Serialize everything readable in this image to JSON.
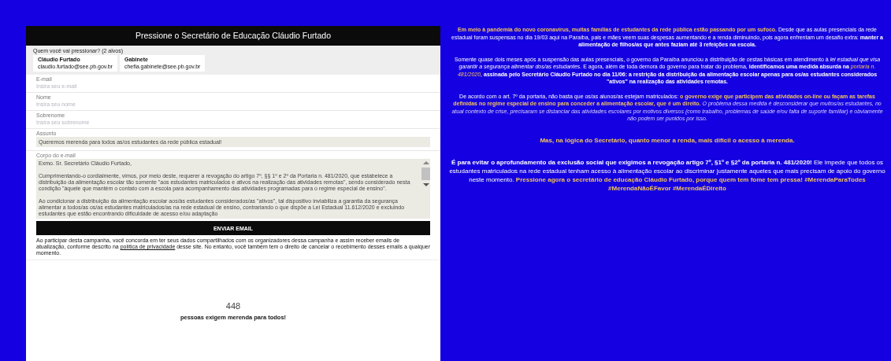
{
  "form": {
    "title": "Pressione o Secretário de Educação Cláudio Furtado",
    "recipients_label": "Quem você vai pressionar? (2 alvos)",
    "recipients": [
      {
        "name": "Cláudio Furtado",
        "email": "claudio.furtado@see.pb.gov.br"
      },
      {
        "name": "Gabinete",
        "email": "chefia.gabinete@see.pb.gov.br"
      }
    ],
    "fields": [
      {
        "kind": "input",
        "label": "E-mail",
        "placeholder": "Insira seu e-mail"
      },
      {
        "kind": "input",
        "label": "Nome",
        "placeholder": "Insira seu nome"
      },
      {
        "kind": "input",
        "label": "Sobrenome",
        "placeholder": "Insira seu sobrenome"
      },
      {
        "kind": "filled",
        "label": "Assunto",
        "value": "Queremos merenda para todos as/os estudantes da rede pública estadual!"
      },
      {
        "kind": "textarea",
        "label": "Corpo do e-mail",
        "value": "Exmo. Sr. Secretário Cláudio Furtado,\n\nCumprimentando-o cordialmente, vimos, por meio deste, requerer a revogação do artigo 7º, §§ 1º e 2º da Portaria n. 481/2020, que estabelece a distribuição da alimentação escolar tão somente \"aos estudantes matriculados e ativos na realização das atividades remotas\", sendo considerado nesta condição \"àquele que mantém o contato com a escola para acompanhamento das atividades programadas para o regime especial de ensino\".\n\nAo condicionar a distribuição da alimentação escolar aos/às estudantes considerados/as \"ativos\", tal dispositivo inviabiliza a garantia da segurança alimentar a todos/as os/as estudantes matriculados/as na rede estadual de ensino, contrariando o que dispõe a Lei Estadual 11.612/2020 e excluindo estudantes que estão encontrando dificuldade de acesso e/ou adaptação"
      }
    ],
    "submit": "ENVIAR EMAIL",
    "disclaimer": [
      {
        "kind": "text",
        "text": "Ao participar desta campanha, você concorda em ter seus dados compartilhados com os organizadores dessa campanha e assim receber emails de atualização, conforme descrito na "
      },
      {
        "kind": "link",
        "text": "política de privacidade"
      },
      {
        "kind": "text",
        "text": " desse site. No entanto, você também tem o direito de cancelar o recebimento desses emails a qualquer momento."
      }
    ],
    "count": "448",
    "count_label": "pessoas exigem merenda para todos!"
  },
  "article": [
    {
      "kind": "body",
      "segments": [
        {
          "kind": "accent",
          "text": "**Em meio à pandemia do novo coronavírus, muitas famílias de estudantes da rede pública estão passando por um sufoco.**"
        },
        {
          "kind": "plain",
          "text": " Desde que as aulas presenciais da rede estadual foram suspensas no dia 19/03 aqui na Paraíba, pais e mães veem suas despesas aumentando e a renda diminuindo, pois agora enfrentam um desafio extra: **manter a alimentação de filhos/as que antes faziam até 3 refeições na escola.**"
        }
      ]
    },
    {
      "kind": "body",
      "segments": [
        {
          "kind": "plain",
          "text": "Somente quase dois meses após a suspensão das aulas presenciais, o governo da Paraíba anunciou a distribuição de cestas básicas em atendimento à *lei estadual que visa garantir a segurança alimentar dos/as estudantes*. E agora, além de toda demora do governo para tratar do problema, **identificamos uma medida absurda na** "
        },
        {
          "kind": "accent",
          "text": "*portaria n. 481/2020*"
        },
        {
          "kind": "plain",
          "text": ", **assinada pelo Secretário Cláudio Furtado no dia 11/06: a restrição da distribuição da alimentação escolar apenas para os/as estudantes considerados \"ativos\" na realização das atividades remotas.**"
        }
      ]
    },
    {
      "kind": "body",
      "segments": [
        {
          "kind": "plain",
          "text": "De acordo com o art. 7º da portaria, não basta que os/as alunos/as estejam matriculados: "
        },
        {
          "kind": "accent",
          "text": "**o governo exige que participem das atividades on-line ou façam as tarefas definidas no regime especial de ensino para conceder a alimentação escolar, que é um direito.**"
        },
        {
          "kind": "soft",
          "text": " *O problema dessa medida é desconsiderar que muitos/as estudantes, no atual contexto de crise, precisaram se distanciar das atividades escolares por motivos diversos (como trabalho, problemas de saúde e/ou falta de suporte familiar) e obviamente não podem ser punidos por isso.*"
        }
      ]
    },
    {
      "kind": "lead",
      "segments": [
        {
          "kind": "accent",
          "text": "**Mas, na lógica do Secretário, quanto menor a renda, mais difícil o acesso à merenda.**"
        }
      ]
    },
    {
      "kind": "lead",
      "segments": [
        {
          "kind": "plain",
          "text": "**É para evitar o aprofundamento da exclusão social que exigimos a revogação artigo 7º, §1º e §2º da portaria n. 481/2020!** Ele impede que todos os estudantes matriculados na rede estadual tenham acesso à alimentação escolar ao discriminar justamente aqueles que mais precisam de apoio do governo neste momento."
        },
        {
          "kind": "accent",
          "text": " **Pressione agora o secretário de educação Cláudio Furtado, porque quem tem fome tem pressa! #MerendaParaTodes #MerendaNãoÉFavor #MerendaÉDireito**"
        }
      ]
    }
  ]
}
